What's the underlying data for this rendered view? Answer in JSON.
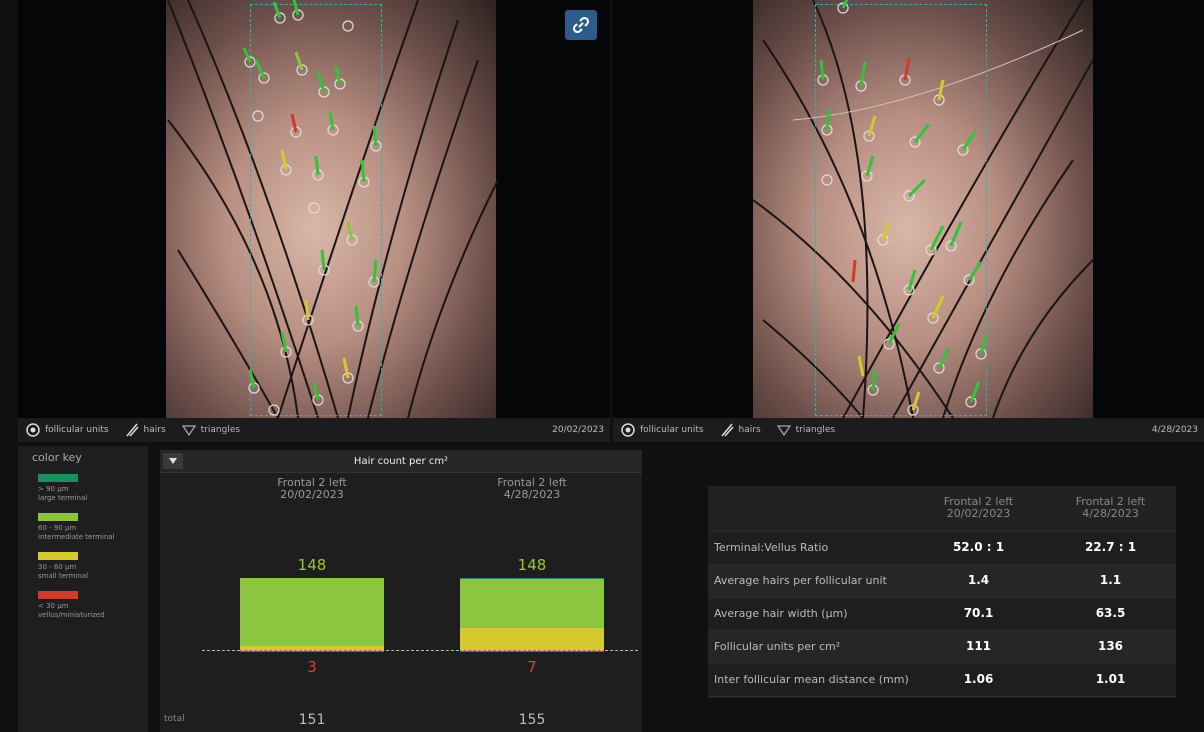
{
  "toolbar": {
    "follicular_label": "follicular units",
    "hairs_label": "hairs",
    "triangles_label": "triangles",
    "left_date": "20/02/2023",
    "right_date": "4/28/2023"
  },
  "color_key": {
    "title": "color key",
    "items": [
      {
        "color": "#1a9060",
        "text": "> 90 µm\nlarge terminal"
      },
      {
        "color": "#8cc63f",
        "text": "60 - 90 µm\nintermediate terminal"
      },
      {
        "color": "#d6c82f",
        "text": "30 - 60 µm\nsmall terminal"
      },
      {
        "color": "#d23a2a",
        "text": "< 30 µm\nvellus/miniaturized"
      }
    ]
  },
  "chart_panel": {
    "title": "Hair count per cm²",
    "total_label": "total"
  },
  "chart_data": {
    "type": "bar",
    "title": "Hair count per cm²",
    "categories": [
      "Frontal 2 left\n20/02/2023",
      "Frontal 2 left\n4/28/2023"
    ],
    "columns": [
      {
        "site": "Frontal 2 left",
        "date": "20/02/2023",
        "terminal_count": "148",
        "vellus_count": "3",
        "total": "151"
      },
      {
        "site": "Frontal 2 left",
        "date": "4/28/2023",
        "terminal_count": "148",
        "vellus_count": "7",
        "total": "155"
      }
    ],
    "series": [
      {
        "name": "> 90 µm large terminal",
        "color": "#1a9060",
        "values": [
          0,
          3
        ]
      },
      {
        "name": "60 - 90 µm intermediate terminal",
        "color": "#8cc63f",
        "values": [
          140,
          99
        ]
      },
      {
        "name": "30 - 60 µm small terminal",
        "color": "#d6c82f",
        "values": [
          8,
          46
        ]
      },
      {
        "name": "< 30 µm vellus/miniaturized",
        "color": "#d23a2a",
        "values": [
          3,
          7
        ]
      }
    ],
    "ylim": [
      0,
      160
    ]
  },
  "metrics_table": {
    "headers": [
      {
        "site": "Frontal 2 left",
        "date": "20/02/2023"
      },
      {
        "site": "Frontal 2 left",
        "date": "4/28/2023"
      }
    ],
    "rows": [
      {
        "label": "Terminal:Vellus Ratio",
        "values": [
          "52.0 : 1",
          "22.7 : 1"
        ]
      },
      {
        "label": "Average hairs per follicular unit",
        "values": [
          "1.4",
          "1.1"
        ]
      },
      {
        "label": "Average hair width (µm)",
        "values": [
          "70.1",
          "63.5"
        ]
      },
      {
        "label": "Follicular units per cm²",
        "values": [
          "111",
          "136"
        ]
      },
      {
        "label": "Inter follicular mean distance (mm)",
        "values": [
          "1.06",
          "1.01"
        ]
      }
    ]
  }
}
